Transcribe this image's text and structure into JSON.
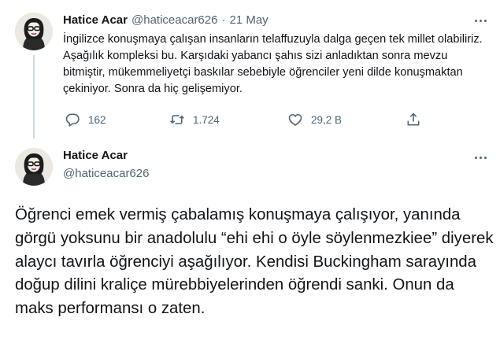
{
  "tweet1": {
    "author_name": "Hatice Acar",
    "handle": "@haticeacar626",
    "separator": "·",
    "date": "21 May",
    "text": "İngilizce konuşmaya çalışan insanların telaffuzuyla dalga geçen tek millet olabiliriz. Aşağılık kompleksi bu. Karşıdaki yabancı şahıs sizi anladıktan sonra mevzu bitmiştir, mükemmeliyetçi baskılar sebebiyle öğrenciler yeni dilde konuşmaktan çekiniyor. Sonra da hiç gelişemiyor.",
    "replies": "162",
    "retweets": "1.724",
    "likes": "29,2 B"
  },
  "tweet2": {
    "author_name": "Hatice Acar",
    "handle": "@haticeacar626",
    "text": "Öğrenci emek vermiş çabalamış konuşmaya çalışıyor, yanında görgü yoksunu bir anadolulu “ehi ehi o öyle söylenmezkiee” diyerek alaycı tavırla öğrenciyi aşağılıyor. Kendisi Buckingham sarayında doğup dilini kraliçe mürebbiyelerinden öğrendi sanki. Onun da maks performansı o zaten."
  },
  "icons": {
    "more": "more-horizontal-icon",
    "reply": "reply-bubble-icon",
    "retweet": "retweet-arrows-icon",
    "like": "heart-icon",
    "share": "share-upload-icon"
  },
  "colors": {
    "text_primary": "#0f1419",
    "text_secondary": "#536471",
    "thread_line": "#cfd9de"
  }
}
